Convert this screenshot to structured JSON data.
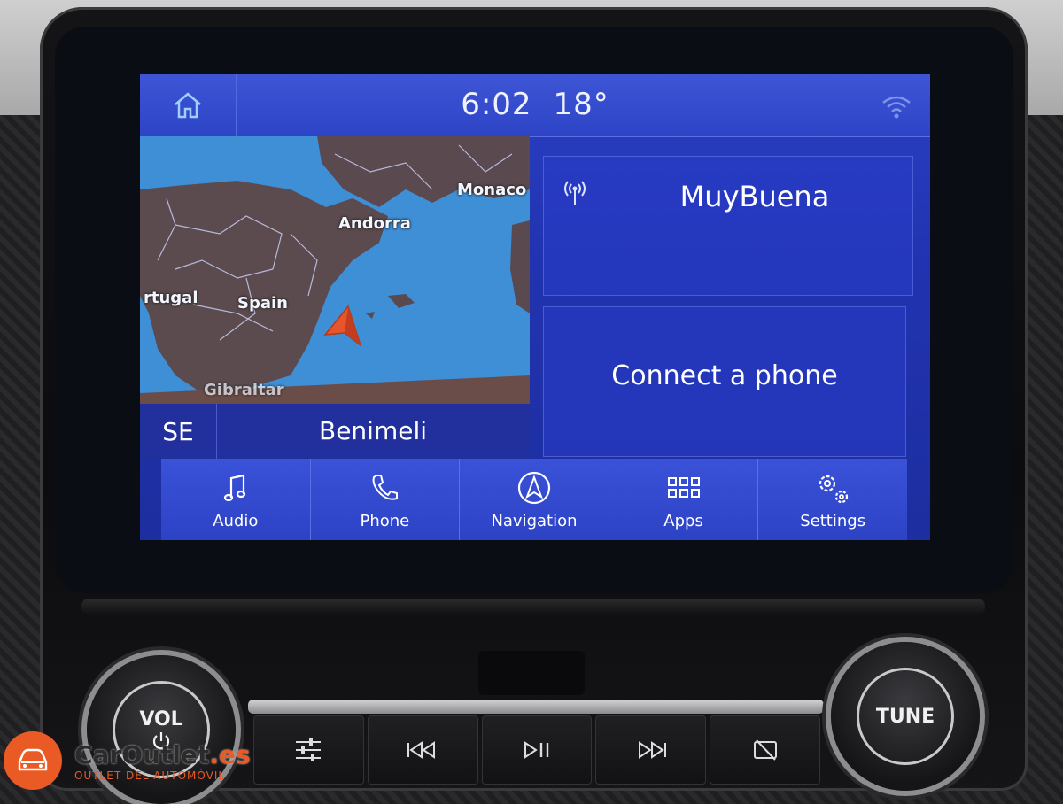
{
  "status": {
    "time": "6:02",
    "temperature": "18°"
  },
  "map": {
    "labels": {
      "monaco": "Monaco",
      "andorra": "Andorra",
      "portugal": "rtugal",
      "spain": "Spain",
      "gibraltar": "Gibraltar"
    },
    "heading": "SE",
    "street": "Benimeli"
  },
  "radio": {
    "station": "MuyBuena"
  },
  "phone": {
    "prompt": "Connect a phone"
  },
  "tabs": [
    {
      "label": "Audio",
      "icon": "music-note-icon"
    },
    {
      "label": "Phone",
      "icon": "phone-icon"
    },
    {
      "label": "Navigation",
      "icon": "navigation-arrow-icon"
    },
    {
      "label": "Apps",
      "icon": "grid-icon"
    },
    {
      "label": "Settings",
      "icon": "gears-icon"
    }
  ],
  "hardware": {
    "vol_label": "VOL",
    "tune_label": "TUNE"
  },
  "watermark": {
    "brand_a": "CarOutlet",
    "brand_b": ".es",
    "tagline": "OUTLET DEL AUTOMÓVIL"
  },
  "colors": {
    "screen_blue": "#2a3fc4",
    "map_sea": "#3f8fd6",
    "nav_arrow": "#e8552a",
    "watermark_orange": "#e95a24"
  }
}
